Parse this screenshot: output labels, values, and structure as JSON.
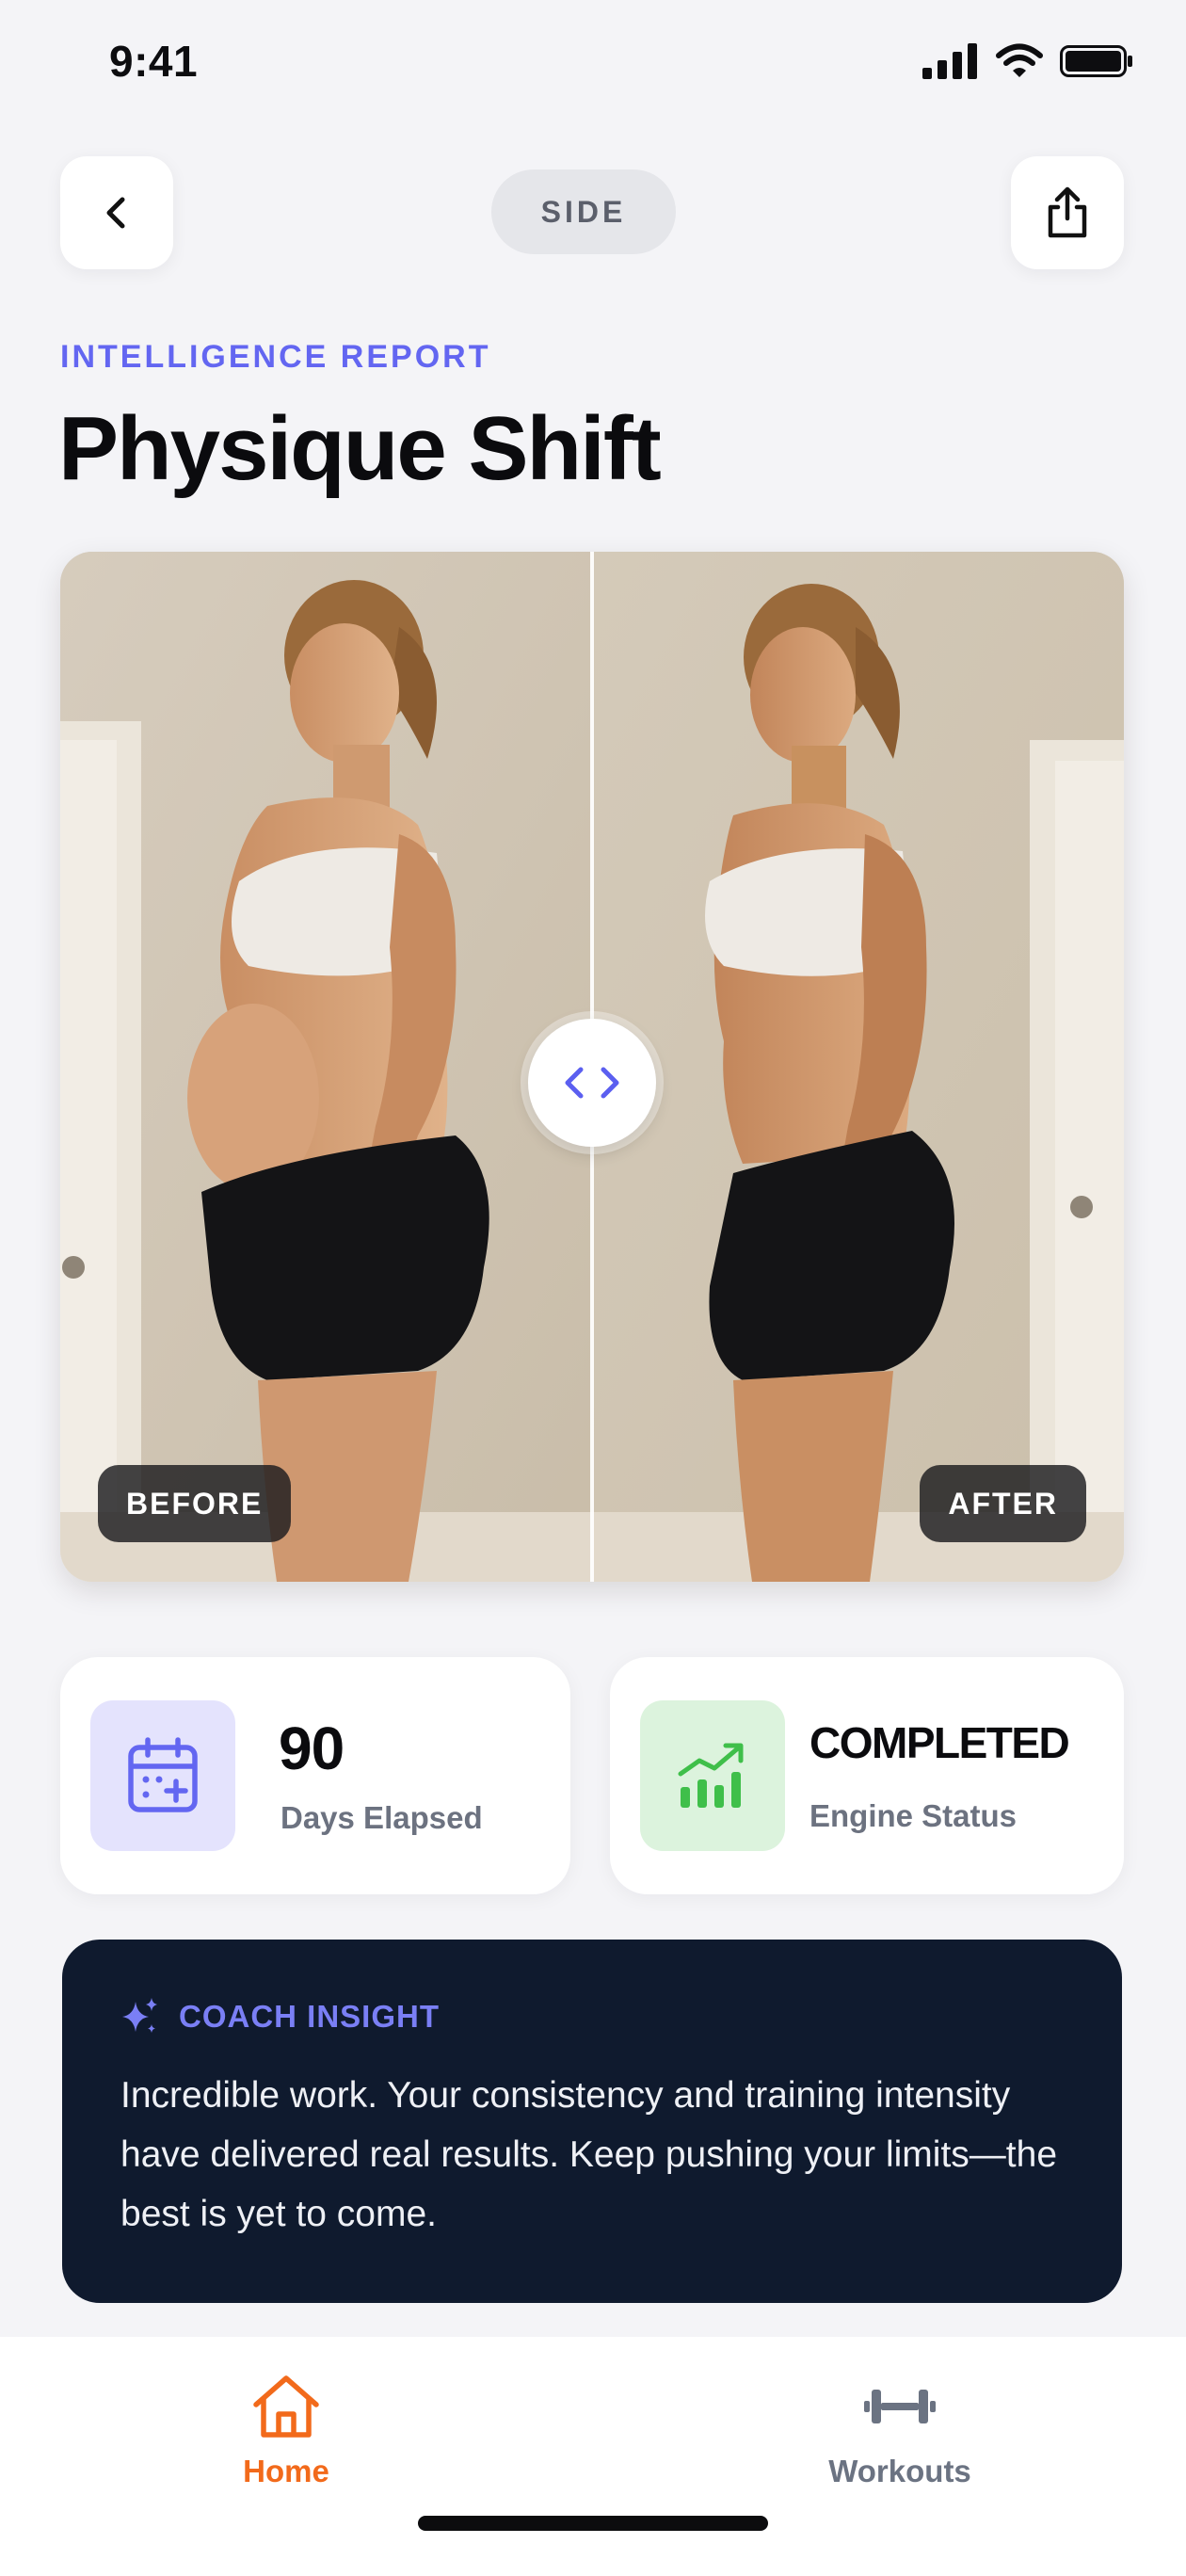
{
  "status_bar": {
    "time": "9:41"
  },
  "header": {
    "view_mode": "SIDE"
  },
  "report": {
    "eyebrow": "INTELLIGENCE REPORT",
    "title": "Physique Shift"
  },
  "comparison": {
    "before_label": "BEFORE",
    "after_label": "AFTER"
  },
  "stats": {
    "days": {
      "value": "90",
      "label": "Days Elapsed",
      "icon": "calendar-plus-icon",
      "accent": "#6366f1"
    },
    "engine": {
      "value": "COMPLETED",
      "label": "Engine Status",
      "icon": "chart-growth-icon",
      "accent": "#3fbf4a"
    }
  },
  "insight": {
    "title": "COACH INSIGHT",
    "icon": "sparkles-icon",
    "body": "Incredible work. Your consistency and training intensity have delivered real results. Keep pushing your limits—the best is yet to come."
  },
  "tab_bar": {
    "items": [
      {
        "label": "Home",
        "icon": "home-icon",
        "active": true
      },
      {
        "label": "Workouts",
        "icon": "dumbbell-icon",
        "active": false
      }
    ],
    "active_color": "#f26a1b"
  },
  "colors": {
    "accent": "#6366f1",
    "dark_card": "#0f1a2e",
    "background": "#f4f4f7"
  }
}
